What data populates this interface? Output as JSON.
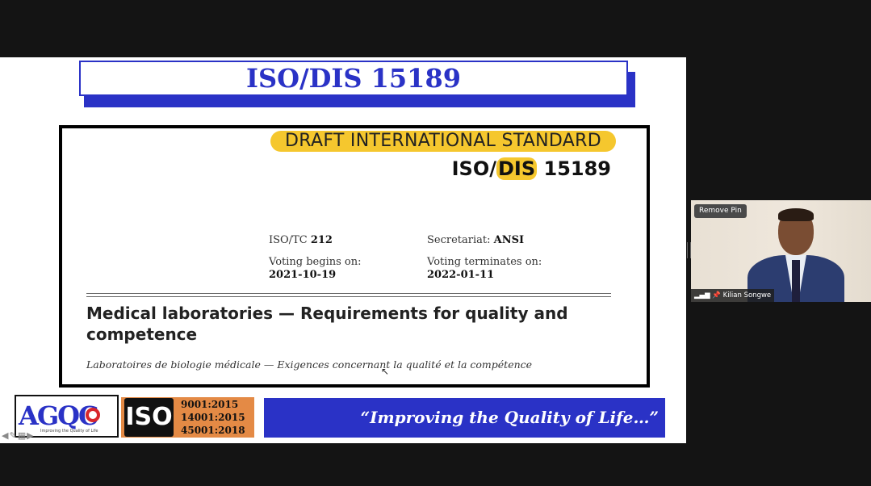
{
  "slide": {
    "title": "ISO/DIS 15189",
    "doc": {
      "banner": "DRAFT INTERNATIONAL STANDARD",
      "iso_prefix": "ISO/",
      "iso_dis": "DIS",
      "iso_num": " 15189",
      "tc_label": "ISO/TC ",
      "tc_value": "212",
      "secretariat_label": "Secretariat: ",
      "secretariat_value": "ANSI",
      "voting_begins_label": "Voting begins on:",
      "voting_begins_value": "2021-10-19",
      "voting_ends_label": "Voting terminates on:",
      "voting_ends_value": "2022-01-11",
      "title": "Medical laboratories — Requirements for quality and competence",
      "subtitle": "Laboratoires de biologie médicale — Exigences concernant la qualité et la compétence"
    },
    "footer": {
      "agqc_logo": "AGQC",
      "agqc_tagline": "Improving the Quality of Life",
      "iso_badge": "ISO",
      "certs": [
        "9001:2015",
        "14001:2015",
        "45001:2018"
      ],
      "motto": "“Improving the Quality of Life…”"
    }
  },
  "video": {
    "remove_pin": "Remove Pin",
    "participant": "Kilian Songwe"
  },
  "icons": [
    "cursor-icon",
    "arrow-left-icon",
    "pen-icon",
    "grid-icon",
    "arrow-right-icon",
    "signal-icon",
    "pin-icon"
  ],
  "colors": {
    "accent_blue": "#2a32c6",
    "highlight_yellow": "#f5c72e",
    "iso_orange": "#e48a45"
  }
}
